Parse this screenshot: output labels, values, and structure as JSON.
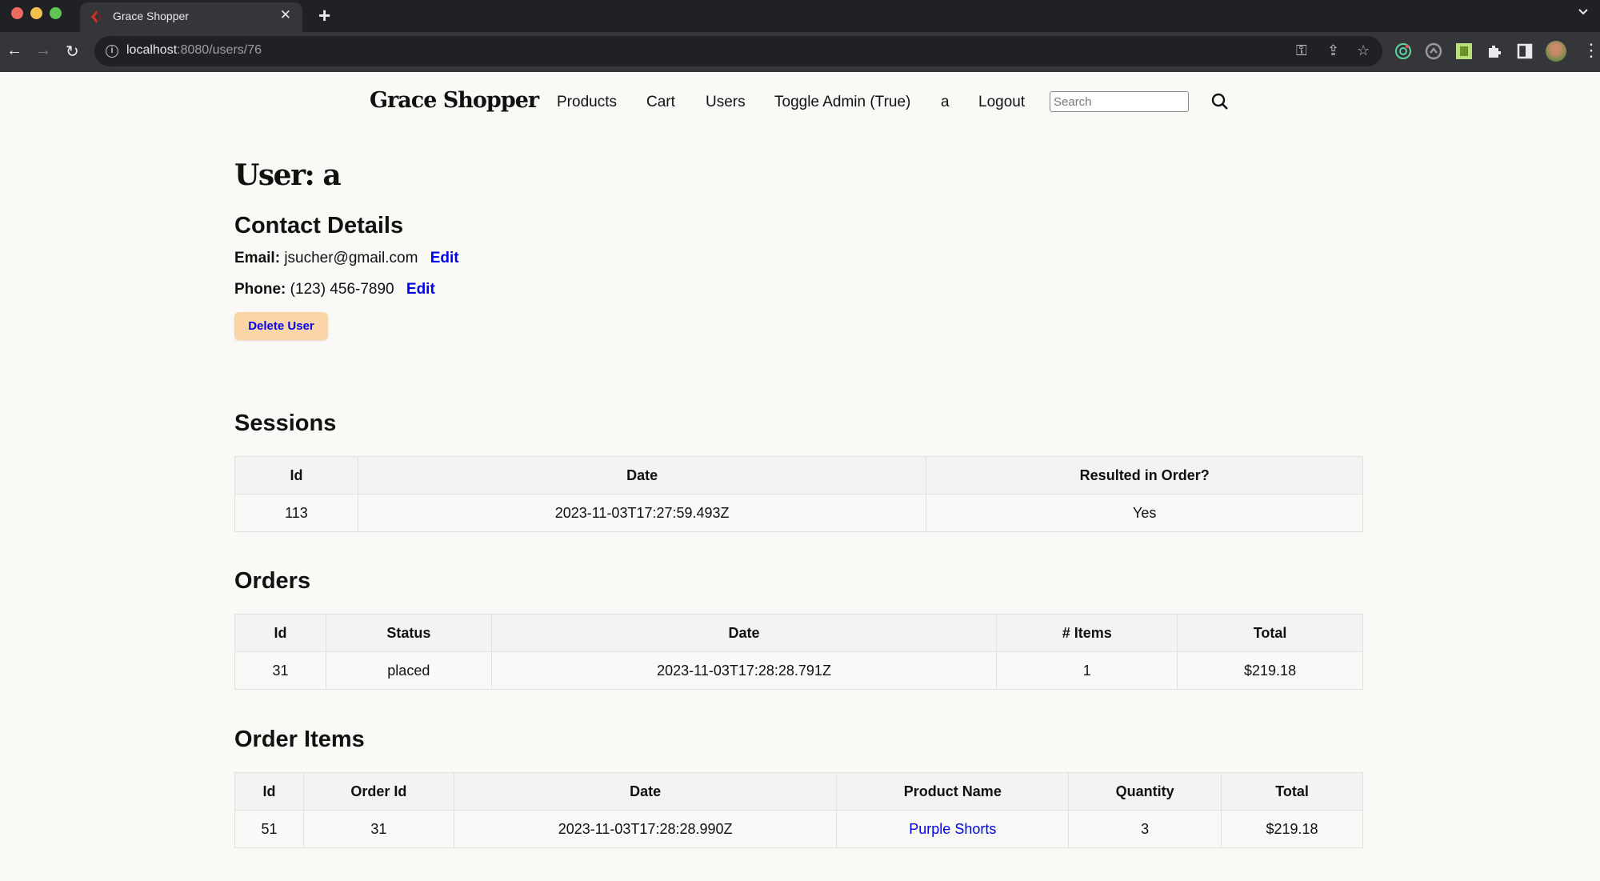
{
  "browser": {
    "tab_title": "Grace Shopper",
    "url_host": "localhost",
    "url_path": ":8080/users/76"
  },
  "nav": {
    "logo": "Grace Shopper",
    "links": [
      "Products",
      "Cart",
      "Users",
      "Toggle Admin (True)",
      "a",
      "Logout"
    ],
    "search_placeholder": "Search"
  },
  "user": {
    "title": "User: a",
    "contact_heading": "Contact Details",
    "email_label": "Email:",
    "email": "jsucher@gmail.com",
    "phone_label": "Phone:",
    "phone": "(123) 456-7890",
    "edit_label": "Edit",
    "delete_label": "Delete User"
  },
  "sessions": {
    "heading": "Sessions",
    "columns": [
      "Id",
      "Date",
      "Resulted in Order?"
    ],
    "rows": [
      [
        "113",
        "2023-11-03T17:27:59.493Z",
        "Yes"
      ]
    ]
  },
  "orders": {
    "heading": "Orders",
    "columns": [
      "Id",
      "Status",
      "Date",
      "# Items",
      "Total"
    ],
    "rows": [
      [
        "31",
        "placed",
        "2023-11-03T17:28:28.791Z",
        "1",
        "$219.18"
      ]
    ]
  },
  "order_items": {
    "heading": "Order Items",
    "columns": [
      "Id",
      "Order Id",
      "Date",
      "Product Name",
      "Quantity",
      "Total"
    ],
    "rows": [
      [
        "51",
        "31",
        "2023-11-03T17:28:28.990Z",
        "Purple Shorts",
        "3",
        "$219.18"
      ]
    ]
  },
  "colors": {
    "link": "#0000ee",
    "delete_button_bg": "#f9d5a8",
    "page_bg": "#faf9f5"
  }
}
